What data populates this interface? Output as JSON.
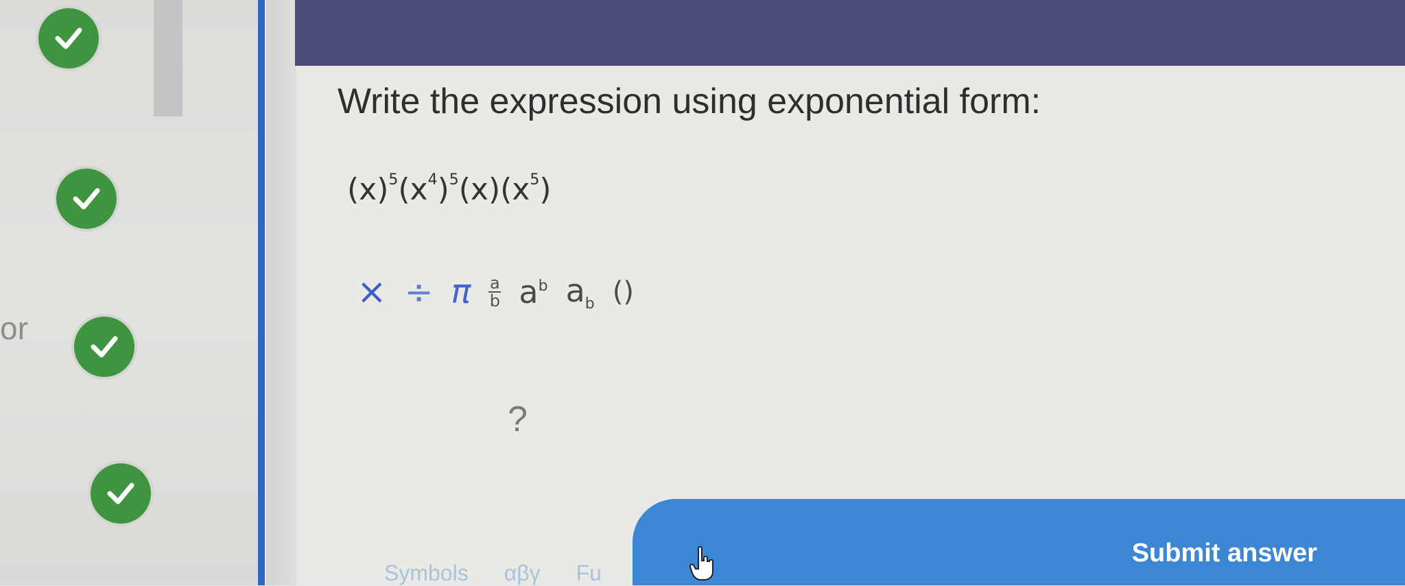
{
  "sidebar": {
    "or_text": "or",
    "progress_checks": [
      "complete",
      "complete",
      "complete",
      "complete"
    ]
  },
  "question": {
    "prompt": "Write the expression using exponential form:",
    "expression": {
      "terms": [
        {
          "base": "(x)",
          "exp": "5"
        },
        {
          "base": "(x",
          "inner_exp": "4",
          "close": ")",
          "exp": "5"
        },
        {
          "base": "(x)",
          "exp": ""
        },
        {
          "base": "(x",
          "inner_exp": "5",
          "close": ")",
          "exp": ""
        }
      ]
    }
  },
  "math_toolbar": {
    "times": "×",
    "divide": "÷",
    "pi": "π",
    "fraction_num": "a",
    "fraction_den": "b",
    "power_base": "a",
    "power_exp": "b",
    "subscript_base": "a",
    "subscript_sub": "b",
    "parens": "()"
  },
  "answer": {
    "placeholder": "?"
  },
  "footer": {
    "tabs": [
      "Symbols",
      "αβγ",
      "Fu"
    ],
    "submit_label": "Submit answer"
  },
  "colors": {
    "header": "#4a4d78",
    "accent_blue": "#2f67c3",
    "submit_blue": "#3d86d4",
    "check_green": "#3f943f"
  }
}
